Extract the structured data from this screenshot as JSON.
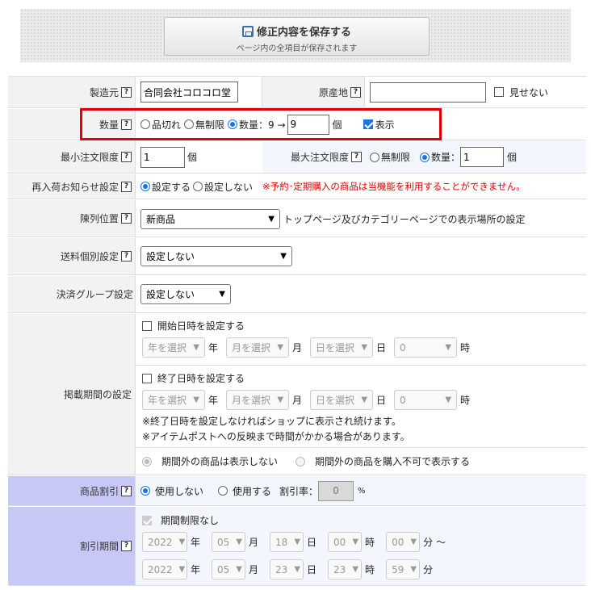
{
  "save": {
    "title": "修正内容を保存する",
    "subtitle": "ページ内の全項目が保存されます"
  },
  "maker": {
    "label": "製造元",
    "value": "合同会社コロコロ堂"
  },
  "origin": {
    "label": "原産地",
    "value": "",
    "hide_label": "見せない"
  },
  "quantity": {
    "label": "数量",
    "opt_soldout": "品切れ",
    "opt_unlimited": "無制限",
    "opt_qty": "数量：9 →",
    "value": "9",
    "unit": "個",
    "show_label": "表示"
  },
  "min_order": {
    "label": "最小注文限度",
    "value": "1",
    "unit": "個"
  },
  "max_order": {
    "label": "最大注文限度",
    "opt_unlimited": "無制限",
    "opt_qty": "数量：",
    "value": "1",
    "unit": "個"
  },
  "restock": {
    "label": "再入荷お知らせ設定",
    "opt_on": "設定する",
    "opt_off": "設定しない",
    "warning": "※予約･定期購入の商品は当機能を利用することができません。"
  },
  "display_position": {
    "label": "陳列位置",
    "selected": "新商品",
    "note": "トップページ及びカテゴリーページでの表示場所の設定"
  },
  "shipping": {
    "label": "送料個別設定",
    "selected": "設定しない"
  },
  "payment_group": {
    "label": "決済グループ設定",
    "selected": "設定しない"
  },
  "period": {
    "label": "掲載期間の設定",
    "start_check": "開始日時を設定する",
    "end_check": "終了日時を設定する",
    "year_ph": "年を選択",
    "year_unit": "年",
    "month_ph": "月を選択",
    "month_unit": "月",
    "day_ph": "日を選択",
    "day_unit": "日",
    "hour_val": "0",
    "hour_unit": "時",
    "note1": "※終了日時を設定しなければショップに表示され続けます。",
    "note2": "※アイテムポストへの反映まで時間がかかる場合があります。",
    "opt_hide": "期間外の商品は表示しない",
    "opt_show": "期間外の商品を購入不可で表示する"
  },
  "discount": {
    "label": "商品割引",
    "opt_no": "使用しない",
    "opt_yes": "使用する",
    "rate_label": "割引率：",
    "rate": "0",
    "pct": "%"
  },
  "discount_period": {
    "label": "割引期間",
    "no_limit": "期間制限なし",
    "start": {
      "year": "2022",
      "month": "05",
      "day": "18",
      "hour": "00",
      "min": "00"
    },
    "end": {
      "year": "2022",
      "month": "05",
      "day": "23",
      "hour": "23",
      "min": "59"
    },
    "u_year": "年",
    "u_month": "月",
    "u_day": "日",
    "u_hour": "時",
    "u_min": "分",
    "tilde": "〜"
  },
  "help_text": "?",
  "icons": {
    "help": "help-icon",
    "save": "save-icon",
    "chevron": "chevron-down-icon"
  },
  "colors": {
    "highlight": "#e0000b",
    "accent": "#1a73e8",
    "warning": "#e00000",
    "label_purple": "#c8c8f6"
  }
}
